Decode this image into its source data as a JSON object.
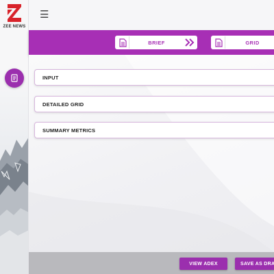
{
  "brand": {
    "logo_text": "ZEE NEWS",
    "accent_color": "#a72fb5",
    "icon": "zee-logo"
  },
  "header": {
    "menu_icon": "hamburger-menu-icon"
  },
  "rail": {
    "active_item_icon": "document-list-icon"
  },
  "steps": {
    "brief_label": "BRIEF",
    "brief_icon": "document-icon",
    "next_icon": "double-chevron-right-icon",
    "grid_label": "GRID",
    "grid_icon": "document-icon"
  },
  "sections": [
    {
      "label": "INPUT"
    },
    {
      "label": "DETAILED GRID"
    },
    {
      "label": "SUMMARY METRICS"
    }
  ],
  "footer": {
    "view_label": "VIEW ADEX",
    "save_label": "SAVE AS DRAFT"
  }
}
